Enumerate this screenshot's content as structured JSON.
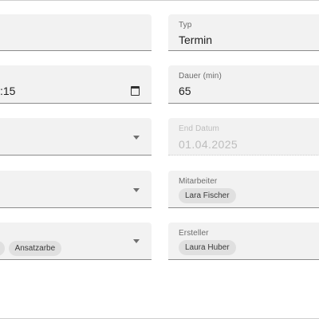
{
  "form": {
    "typ": {
      "label": "Typ",
      "value": "Termin"
    },
    "time_field": {
      "value": ":15"
    },
    "dauer": {
      "label": "Dauer (min)",
      "value": "65"
    },
    "end_datum": {
      "label": "End Datum",
      "value": "01.04.2025"
    },
    "mitarbeiter": {
      "label": "Mitarbeiter",
      "chips": [
        "Lara Fischer"
      ]
    },
    "ersteller": {
      "label": "Ersteller",
      "chips": [
        "Laura Huber"
      ]
    },
    "left_chips": [
      "e",
      "Ansatzarbe"
    ]
  },
  "icons": {
    "calendar": "calendar-icon",
    "dropdown": "chevron-down-icon"
  },
  "colors": {
    "field_background": "#f2f2f2",
    "chip_background": "#e0e0e0",
    "disabled_text": "#bdbdbd"
  }
}
